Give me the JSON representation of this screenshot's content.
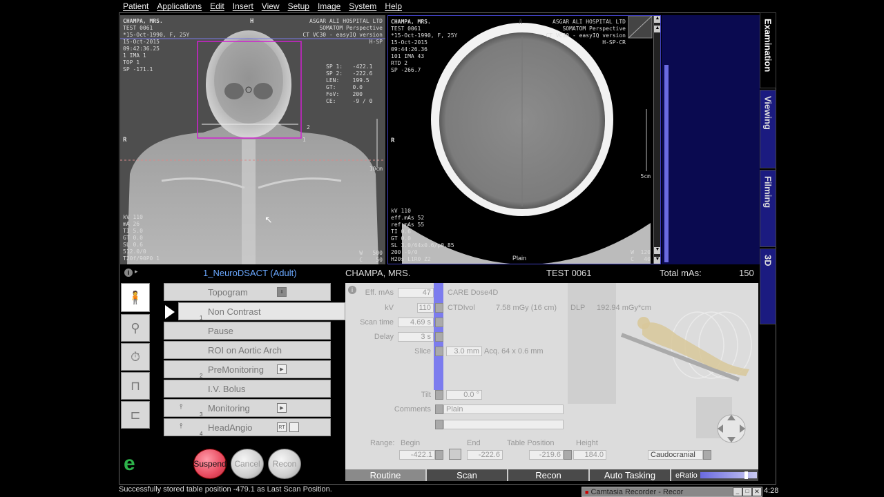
{
  "menu": [
    "Patient",
    "Applications",
    "Edit",
    "Insert",
    "View",
    "Setup",
    "Image",
    "System",
    "Help"
  ],
  "topogram": {
    "top_left": [
      "CHAMPA, MRS.",
      "TEST 0061",
      "*15-Oct-1990, F, 25Y",
      "15-Oct-2015",
      "09:42:36.25",
      "1 IMA 1",
      "TOP 1",
      "SP -171.1"
    ],
    "top_right": [
      "ASGAR ALI HOSPITAL LTD",
      "SOMATOM Perspective",
      "CT VC30 - easyIQ version",
      "H-SP"
    ],
    "orientation_top": "H",
    "orientation_left": "R",
    "measure": [
      "SP 1:   -422.1",
      "SP 2:   -222.6",
      "LEN:    199.5",
      "GT:     0.0",
      "FoV:    200",
      "CE:     -9 / 0"
    ],
    "bottom_left": [
      "kV 110",
      "mA 26",
      "TI 5.0",
      "GT 0.0",
      "SL 0.6",
      "512.0/0",
      "T20f/90P0 1"
    ],
    "scale_label": "10cm",
    "wl": [
      "W   500",
      "C    50"
    ],
    "box_labels": [
      "1",
      "2"
    ]
  },
  "axial": {
    "top_left": [
      "CHAMPA, MRS.",
      "TEST 0061",
      "*15-Oct-1990, F, 25Y",
      "15-Oct-2015",
      "09:44:26.36",
      "101 IMA 43",
      "RTD 2",
      "SP -266.7"
    ],
    "top_right": [
      "ASGAR ALI HOSPITAL LTD",
      "SOMATOM Perspective",
      "CT VC30 - easyIQ version",
      "H-SP-CR"
    ],
    "orientation_top": "A",
    "orientation_left": "R",
    "bottom_left": [
      "kV 110",
      "eff.mAs 52",
      "ref.mAs 55",
      "TI 0.6",
      "GT 0.0",
      "SL 3.0/64x0.6/p0.85",
      "200 -9/0",
      "H20s L1R0 Z2"
    ],
    "bottom_center": "Plain",
    "scale_label": "5cm",
    "wl": [
      "W  120",
      "C   40"
    ]
  },
  "right_tabs": [
    "Examination",
    "Viewing",
    "Filming",
    "3D"
  ],
  "info": {
    "protocol": "1_NeuroDSACT (Adult)",
    "patient": "CHAMPA, MRS.",
    "patient_id": "TEST 0061",
    "total_mas_label": "Total mAs:",
    "total_mas_value": "150"
  },
  "protocol_steps": [
    {
      "label": "Topogram",
      "num": ""
    },
    {
      "label": "Non Contrast",
      "num": "1"
    },
    {
      "label": "Pause",
      "num": ""
    },
    {
      "label": "ROI on Aortic Arch",
      "num": ""
    },
    {
      "label": "PreMonitoring",
      "num": "2"
    },
    {
      "label": "I.V. Bolus",
      "num": ""
    },
    {
      "label": "Monitoring",
      "num": "3"
    },
    {
      "label": "HeadAngio",
      "num": "4"
    }
  ],
  "headangio_rt": "RT",
  "buttons": {
    "suspend": "Suspend",
    "cancel": "Cancel",
    "recon": "Recon"
  },
  "params": {
    "eff_mas_label": "Eff. mAs",
    "eff_mas": "47",
    "kv_label": "kV",
    "kv": "110",
    "scan_time_label": "Scan time",
    "scan_time": "4.69 s",
    "delay_label": "Delay",
    "delay": "3 s",
    "slice_label": "Slice",
    "slice": "3.0 mm",
    "acq": "Acq. 64 x 0.6 mm",
    "tilt_label": "Tilt",
    "tilt": "0.0 °",
    "comments_label": "Comments",
    "comments": "Plain",
    "care_dose": "CARE Dose4D",
    "ctdivol_label": "CTDIvol",
    "ctdivol": "7.58 mGy (16 cm)",
    "dlp_label": "DLP",
    "dlp": "192.94 mGy*cm",
    "range_label": "Range:",
    "begin_label": "Begin",
    "begin": "-422.1",
    "end_label": "End",
    "end": "-222.6",
    "table_pos_label": "Table Position",
    "table_pos": "-219.6",
    "height_label": "Height",
    "height": "184.0",
    "direction": "Caudocranial"
  },
  "bottom_tabs": [
    "Routine",
    "Scan",
    "Recon",
    "Auto Tasking"
  ],
  "eratio_label": "eRatio",
  "status": "Successfully stored table position -479.1 as Last Scan Position.",
  "taskbar": {
    "app": "Camtasia Recorder - Recor",
    "clock": "4:28"
  },
  "colors": {
    "accent": "#6a6ae0",
    "protocol_text": "#6aa8ff",
    "suspend": "#e84a5f"
  }
}
